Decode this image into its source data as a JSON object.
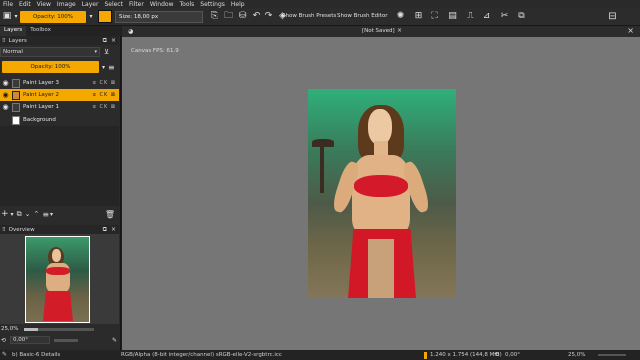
{
  "menu": [
    "File",
    "Edit",
    "View",
    "Image",
    "Layer",
    "Select",
    "Filter",
    "Window",
    "Tools",
    "Settings",
    "Help"
  ],
  "toolbar": {
    "opacity_label": "Opacity: 100%",
    "size_label": "Size: 18,00 px",
    "show_brush_presets": "Show Brush Presets",
    "show_brush_editor": "Show Brush Editor"
  },
  "panel": {
    "tabs": [
      "Layers",
      "Toolbox"
    ],
    "title": "Layers",
    "blend_mode": "Normal",
    "opacity_label": "Opacity:  100%",
    "layers": [
      {
        "name": "Paint Layer 3",
        "selected": false
      },
      {
        "name": "Paint Layer 2",
        "selected": true
      },
      {
        "name": "Paint Layer 1",
        "selected": false
      },
      {
        "name": "Background",
        "selected": false
      }
    ],
    "layer_flags": "α CK ⊠",
    "overview_title": "Overview",
    "zoom_value": "25,0%",
    "rotation_value": "0,00°"
  },
  "document": {
    "title": "[Not Saved]",
    "close_glyph": "×",
    "fps_label": "Canvas FPS: 61.9"
  },
  "status": {
    "brush": "b) Basic-6 Details",
    "color_info": "RGB/Alpha (8-bit integer/channel)  sRGB-elle-V2-srgbtrc.icc",
    "dimensions": "1.240 x 1.754 (144,8 MiB)",
    "rotation": "0,00°",
    "zoom": "25,0%"
  },
  "colors": {
    "accent": "#f4a800",
    "canvas_bg": "#767676",
    "panel_bg": "#2b2b2b"
  }
}
